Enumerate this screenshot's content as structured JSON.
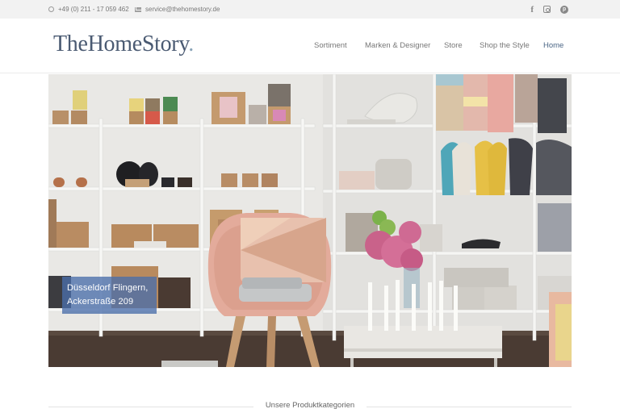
{
  "topbar": {
    "phone": "+49 (0) 211 - 17 059 462",
    "email": "service@thehomestory.de",
    "social": [
      "facebook-icon",
      "instagram-icon",
      "pinterest-icon"
    ]
  },
  "header": {
    "logo_text": "TheHomeStory",
    "logo_dot": ".",
    "nav": [
      {
        "label": "Sortiment"
      },
      {
        "label": "Marken & Designer"
      },
      {
        "label": "Store"
      },
      {
        "label": "Shop the Style"
      },
      {
        "label": "Home"
      }
    ]
  },
  "hero": {
    "caption_line1": "Düsseldorf Flingern,",
    "caption_line2": "Ackerstraße 209"
  },
  "section": {
    "title": "Unsere Produktkategorien"
  },
  "colors": {
    "logo": "#4a5a72",
    "nav_active": "#4b6685",
    "caption_bg": "#4a6eaa",
    "topbar_bg": "#f2f2f2"
  }
}
